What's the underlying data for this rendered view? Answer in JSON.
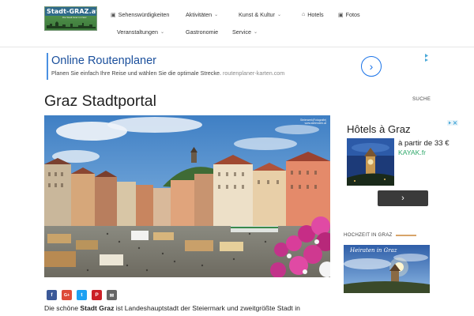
{
  "header": {
    "logo_text": "Stadt-GRAZ.at",
    "logo_tagline": "Die Stadt Graz im Netz",
    "nav": [
      {
        "label": "Sehenswürdigkeiten",
        "icon": "image-icon",
        "dropdown": false
      },
      {
        "label": "Aktivitäten",
        "icon": "",
        "dropdown": true
      },
      {
        "label": "Kunst & Kultur",
        "icon": "",
        "dropdown": true
      },
      {
        "label": "Hotels",
        "icon": "home-icon",
        "dropdown": false
      },
      {
        "label": "Fotos",
        "icon": "image-icon",
        "dropdown": false
      },
      {
        "label": "Veranstaltungen",
        "icon": "",
        "dropdown": true
      },
      {
        "label": "Gastronomie",
        "icon": "",
        "dropdown": false
      },
      {
        "label": "Service",
        "icon": "",
        "dropdown": true
      }
    ]
  },
  "ad_banner": {
    "title": "Online Routenplaner",
    "description": "Planen Sie einfach Ihre Reise und wählen Sie die optimale Strecke.",
    "url": "routenplaner-karten.com"
  },
  "main": {
    "page_title": "Graz Stadtportal",
    "photo_credit_line1": "Steierwerk|Fotografie|",
    "photo_credit_line2": "www.steierwerk.at",
    "share_buttons": [
      {
        "name": "facebook",
        "glyph": "f",
        "color": "#3b5998"
      },
      {
        "name": "google-plus",
        "glyph": "G+",
        "color": "#dd4b39"
      },
      {
        "name": "twitter",
        "glyph": "t",
        "color": "#1da1f2"
      },
      {
        "name": "pinterest",
        "glyph": "P",
        "color": "#cb2027"
      },
      {
        "name": "email",
        "glyph": "✉",
        "color": "#666666"
      }
    ],
    "intro_prefix": "Die schöne",
    "intro_bold": "Stadt Graz",
    "intro_rest": "ist Landeshauptstadt der Steiermark und zweitgrößte Stadt in"
  },
  "sidebar": {
    "search_label": "SUCHE",
    "ad": {
      "title": "Hôtels à Graz",
      "price": "à partir de 33 €",
      "brand": "KAYAK.fr",
      "button_glyph": "›"
    },
    "section_title": "HOCHZEIT IN GRAZ",
    "image_caption": "Heiraten in Graz"
  }
}
